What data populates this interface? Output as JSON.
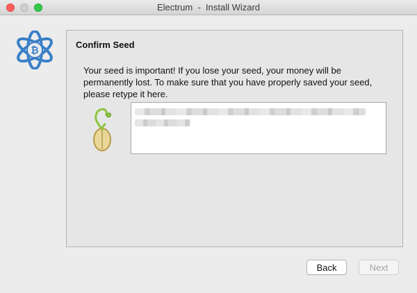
{
  "window": {
    "title": "Electrum  -  Install Wizard"
  },
  "page": {
    "heading": "Confirm Seed",
    "message": "Your seed is important! If you lose your seed, your money will be permanently lost. To make sure that you have properly saved your seed, please retype it here."
  },
  "buttons": {
    "back": "Back",
    "next": "Next"
  },
  "icons": {
    "logo": "electrum-logo-icon",
    "sprout": "seed-sprout-icon"
  },
  "colors": {
    "logo_blue": "#3a7fc8",
    "sprout_green": "#8cc63e",
    "seed_yellow": "#e9d79a"
  }
}
